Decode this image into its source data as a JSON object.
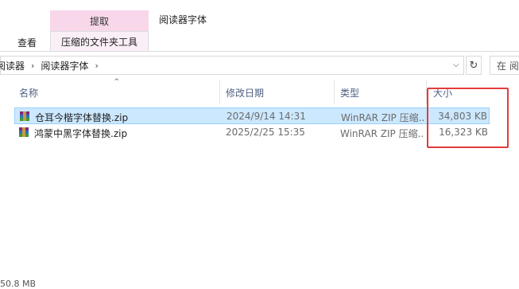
{
  "ribbon": {
    "context_group": "提取",
    "view_tab": "查看",
    "compressed_tab": "压缩的文件夹工具"
  },
  "window": {
    "title": "阅读器字体"
  },
  "address": {
    "crumbs": [
      "阅读器",
      "阅读器字体"
    ],
    "search_placeholder": "在 阅"
  },
  "columns": {
    "name": "名称",
    "modified": "修改日期",
    "type": "类型",
    "size": "大小"
  },
  "files": [
    {
      "name": "仓耳今楷字体替换.zip",
      "modified": "2024/9/14 14:31",
      "type": "WinRAR ZIP 压缩...",
      "size": "34,803 KB"
    },
    {
      "name": "鸿蒙中黑字体替换.zip",
      "modified": "2025/2/25 15:35",
      "type": "WinRAR ZIP 压缩...",
      "size": "16,323 KB"
    }
  ],
  "status": {
    "text": "50.8 MB"
  },
  "colors": {
    "annotation": "#e33b3b",
    "selection": "#cce8ff",
    "context_tab": "#f8d7ea"
  },
  "icons": {
    "archive": "winrar-zip-icon",
    "refresh": "refresh-icon",
    "dropdown": "chevron-down-icon",
    "sort": "sort-up-icon"
  }
}
